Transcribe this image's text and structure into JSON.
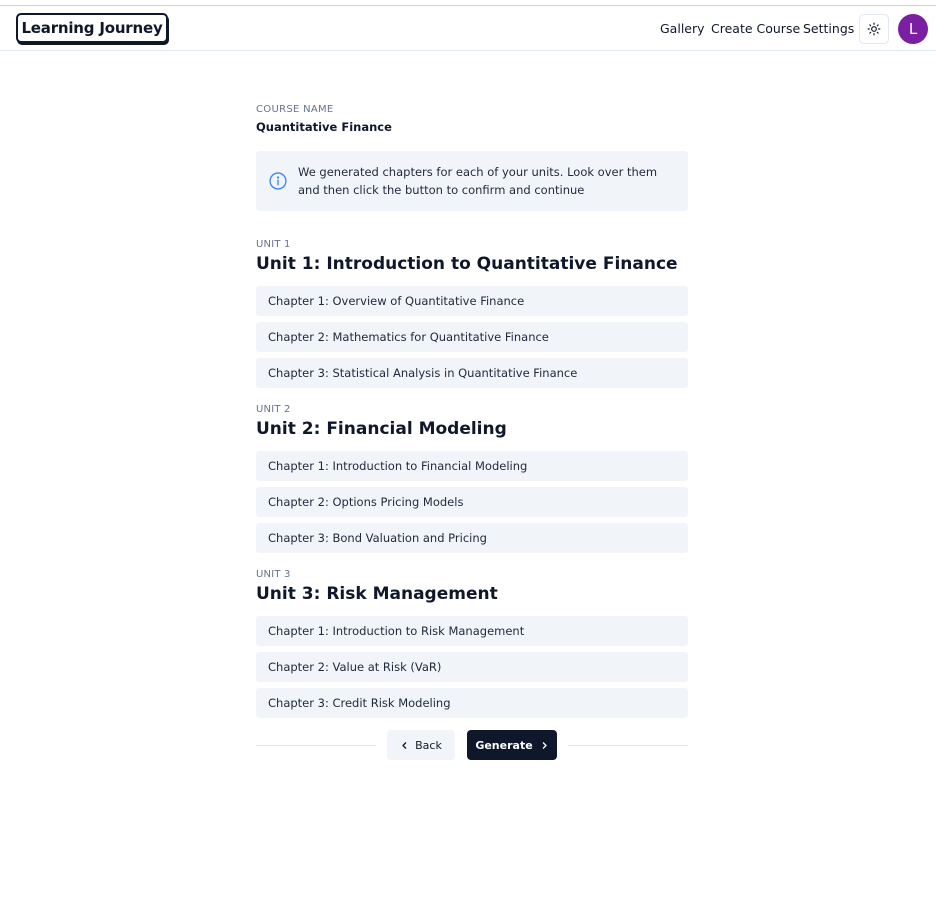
{
  "app": {
    "logo": "Learning Journey",
    "nav": [
      {
        "label": "Gallery"
      },
      {
        "label": "Create Course"
      },
      {
        "label": "Settings"
      }
    ],
    "avatar_initial": "L",
    "avatar_color": "#7b1fa2",
    "theme_icon": "sun-icon"
  },
  "course": {
    "label": "COURSE NAME",
    "name": "Quantitative Finance"
  },
  "info": {
    "icon": "info-icon",
    "text": "We generated chapters for each of your units. Look over them and then click the button to confirm and continue"
  },
  "units": [
    {
      "label": "UNIT 1",
      "title": "Unit 1: Introduction to Quantitative Finance",
      "chapters": [
        "Chapter 1: Overview of Quantitative Finance",
        "Chapter 2: Mathematics for Quantitative Finance",
        "Chapter 3: Statistical Analysis in Quantitative Finance"
      ]
    },
    {
      "label": "UNIT 2",
      "title": "Unit 2: Financial Modeling",
      "chapters": [
        "Chapter 1: Introduction to Financial Modeling",
        "Chapter 2: Options Pricing Models",
        "Chapter 3: Bond Valuation and Pricing"
      ]
    },
    {
      "label": "UNIT 3",
      "title": "Unit 3: Risk Management",
      "chapters": [
        "Chapter 1: Introduction to Risk Management",
        "Chapter 2: Value at Risk (VaR)",
        "Chapter 3: Credit Risk Modeling"
      ]
    }
  ],
  "actions": {
    "back_label": "Back",
    "back_icon": "chevron-left-icon",
    "generate_label": "Generate",
    "generate_icon": "chevron-right-icon"
  }
}
